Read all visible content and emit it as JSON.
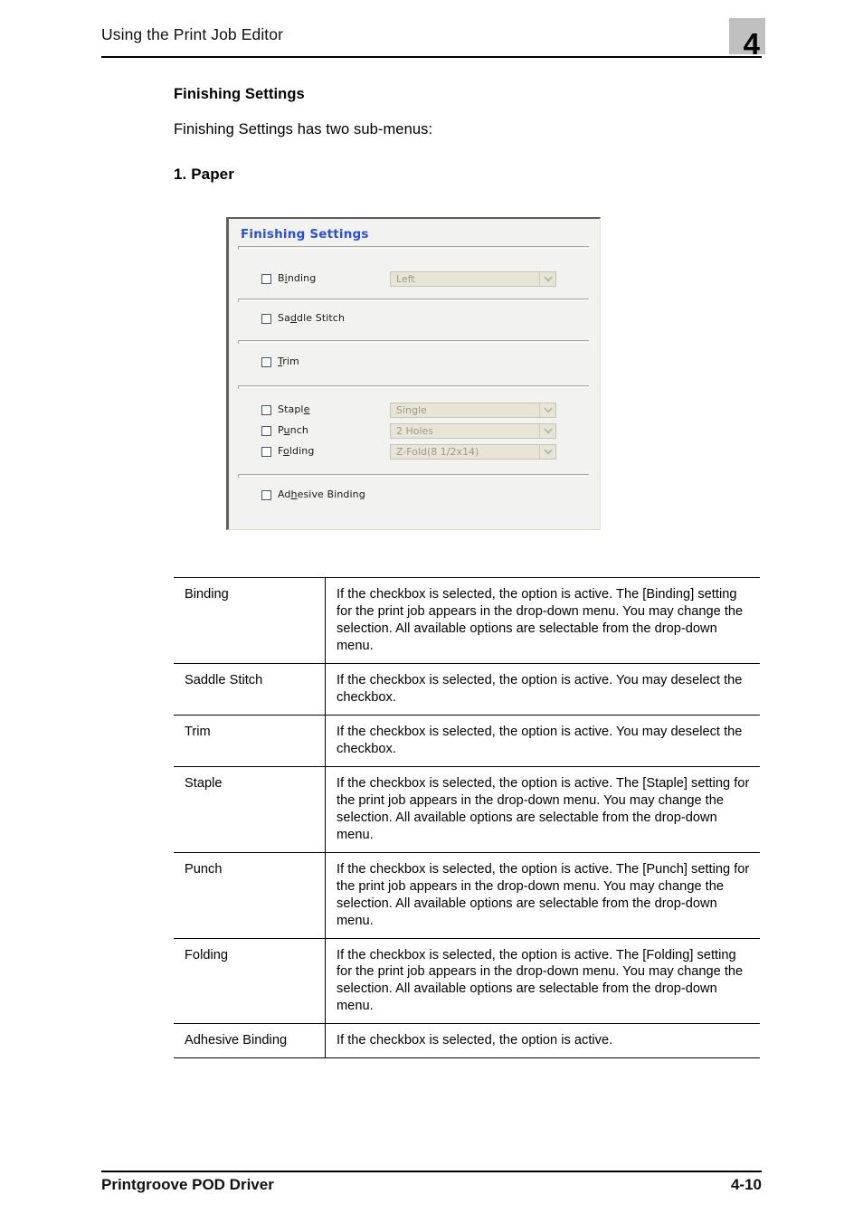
{
  "header": {
    "title": "Using the Print Job Editor",
    "chapter_number": "4",
    "chapter_box_color": "#c0c0c0"
  },
  "content": {
    "section_heading": "Finishing Settings",
    "intro_paragraph": "Finishing Settings has two sub-menus:",
    "subsection_heading": "1. Paper"
  },
  "dialog": {
    "title": "Finishing Settings",
    "title_color": "#2b4fd4",
    "background_color": "#f2f2f1",
    "disabled_field_color": "#e9e5d6",
    "rows": [
      {
        "label_before": "B",
        "label_mnemonic": "i",
        "label_after": "nding",
        "label_full": "Binding",
        "has_combo": true,
        "combo_value": "Left",
        "combo_enabled": false
      },
      {
        "label_before": "Sa",
        "label_mnemonic": "d",
        "label_after": "dle Stitch",
        "label_full": "Saddle Stitch",
        "has_combo": false,
        "combo_value": "",
        "combo_enabled": false
      },
      {
        "label_before": "",
        "label_mnemonic": "T",
        "label_after": "rim",
        "label_full": "Trim",
        "has_combo": false,
        "combo_value": "",
        "combo_enabled": false
      },
      {
        "label_before": "Stapl",
        "label_mnemonic": "e",
        "label_after": "",
        "label_full": "Staple",
        "has_combo": true,
        "combo_value": "Single",
        "combo_enabled": false
      },
      {
        "label_before": "P",
        "label_mnemonic": "u",
        "label_after": "nch",
        "label_full": "Punch",
        "has_combo": true,
        "combo_value": "2 Holes",
        "combo_enabled": false
      },
      {
        "label_before": "F",
        "label_mnemonic": "o",
        "label_after": "lding",
        "label_full": "Folding",
        "has_combo": true,
        "combo_value": "Z-Fold(8 1/2x14)",
        "combo_enabled": false
      },
      {
        "label_before": "Ad",
        "label_mnemonic": "h",
        "label_after": "esive Binding",
        "label_full": "Adhesive Binding",
        "has_combo": false,
        "combo_value": "",
        "combo_enabled": false
      }
    ]
  },
  "table": {
    "rows": [
      {
        "term": "Binding",
        "description": "If the checkbox is selected, the option is active. The [Binding] setting for the print job appears in the drop-down menu. You may change the selection. All available options are selectable from the drop-down menu."
      },
      {
        "term": "Saddle Stitch",
        "description": "If the checkbox is selected, the option is active. You may deselect the checkbox."
      },
      {
        "term": "Trim",
        "description": "If the checkbox is selected, the option is active. You may deselect the checkbox."
      },
      {
        "term": "Staple",
        "description": "If the checkbox is selected, the option is active. The [Staple] setting for the print job appears in the drop-down menu. You may change the selection. All available options are selectable from the drop-down menu."
      },
      {
        "term": "Punch",
        "description": "If the checkbox is selected, the option is active. The [Punch] setting for the print job appears in the drop-down menu. You may change the selection. All available options are selectable from the drop-down menu."
      },
      {
        "term": "Folding",
        "description": "If the checkbox is selected, the option is active. The [Folding] setting for the print job appears in the drop-down menu. You may change the selection. All available options are selectable from the drop-down menu."
      },
      {
        "term": "Adhesive Binding",
        "description": "If the checkbox is selected, the option is active."
      }
    ]
  },
  "footer": {
    "document_name": "Printgroove POD Driver",
    "page_number": "4-10"
  }
}
